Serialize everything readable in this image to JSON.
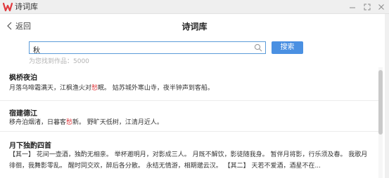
{
  "window": {
    "title": "诗词库",
    "logo_icon": "wps-logo-icon",
    "logo_color": "#e0393e",
    "controls": {
      "minimize": "minimize-icon",
      "maximize": "maximize-icon",
      "close": "close-icon"
    }
  },
  "header": {
    "back_label": "返回",
    "back_icon": "chevron-left-icon",
    "title": "诗词库"
  },
  "search": {
    "query": "秋",
    "button_label": "搜索",
    "icon": "search-icon",
    "result_count": "为您找到作品：5000",
    "accent_color": "#4a90e2"
  },
  "results": [
    {
      "title": "枫桥夜泊",
      "text_before": "月落乌啼霜满天，江枫渔火对",
      "highlight": "愁",
      "text_after": "眠。 姑苏城外寒山寺，夜半钟声到客船。",
      "line2": ""
    },
    {
      "title": "宿建德江",
      "text_before": "移舟泊烟渚，日暮客",
      "highlight": "愁",
      "text_after": "新。 野旷天低树，江清月近人。",
      "line2": ""
    },
    {
      "title": "月下独酌四首",
      "text_before": "【其一】 花间一壶酒，独酌无相亲。 举杯邀明月，对影成三人。 月既不解饮，影徒随我身。 暂伴月将影，行乐须及春。 我歌月",
      "highlight": "",
      "text_after": "",
      "line2": "徘徊，我舞影零乱。 醒时同交欢，醉后各分散。 永结无情游，相期邈云汉。 【其二】 天若不爱酒，酒星不在..."
    }
  ],
  "highlight_color": "#e0393e"
}
